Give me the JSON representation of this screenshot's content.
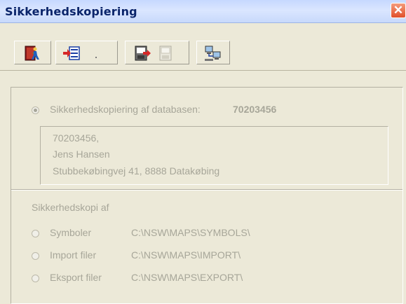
{
  "window": {
    "title": "Sikkerhedskopiering",
    "close_label": "✕"
  },
  "toolbar": {
    "buttons": [
      {
        "icon": "exit-door-icon"
      },
      {
        "icon": "import-record-icon"
      },
      {
        "icon": "backup-disk-icon"
      },
      {
        "icon": "restore-disk-icon",
        "disabled": true
      },
      {
        "icon": "network-computers-icon"
      }
    ]
  },
  "database": {
    "radio_label": "Sikkerhedskopiering af databasen:",
    "number": "70203456",
    "checked": true,
    "address": {
      "line1": "70203456,",
      "line2": "Jens Hansen",
      "line3": "Stubbekøbingvej 41, 8888 Datakøbing"
    }
  },
  "backup_of": {
    "heading": "Sikkerhedskopi af",
    "options": [
      {
        "label": "Symboler",
        "path": "C:\\NSW\\MAPS\\SYMBOLS\\"
      },
      {
        "label": "Import filer",
        "path": "C:\\NSW\\MAPS\\IMPORT\\"
      },
      {
        "label": "Eksport filer",
        "path": "C:\\NSW\\MAPS\\EXPORT\\"
      }
    ]
  },
  "colors": {
    "title_text": "#0a246a",
    "disabled_text": "#a7a699",
    "dialog_bg": "#ece9d8",
    "close_button": "#e1502a"
  }
}
